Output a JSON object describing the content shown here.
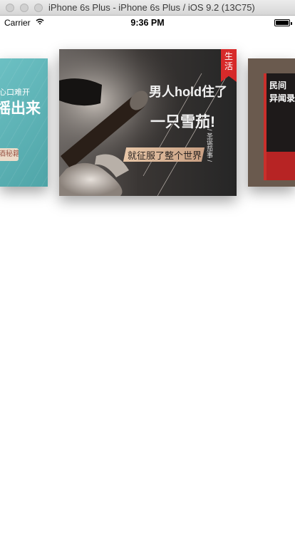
{
  "window": {
    "title": "iPhone 6s Plus - iPhone 6s Plus / iOS 9.2 (13C75)"
  },
  "status_bar": {
    "carrier": "Carrier",
    "time": "9:36 PM",
    "wifi_icon": "wifi-icon",
    "battery_icon": "battery-icon",
    "battery_level": 1.0
  },
  "carousel": {
    "selected_index": 1,
    "cards": [
      {
        "line1": "心口难开",
        "line2": "摇出来",
        "button": "酒秘籍",
        "color": "#5fb4b7"
      },
      {
        "ribbon": "生活",
        "line1": "男人hold住了",
        "line2": "一只雪茄!",
        "band": "就征服了整个世界",
        "side": "/ 圣诞茄事 /"
      },
      {
        "title_line1": "民间",
        "title_line2": "异闻录",
        "color": "#b72424"
      }
    ]
  }
}
